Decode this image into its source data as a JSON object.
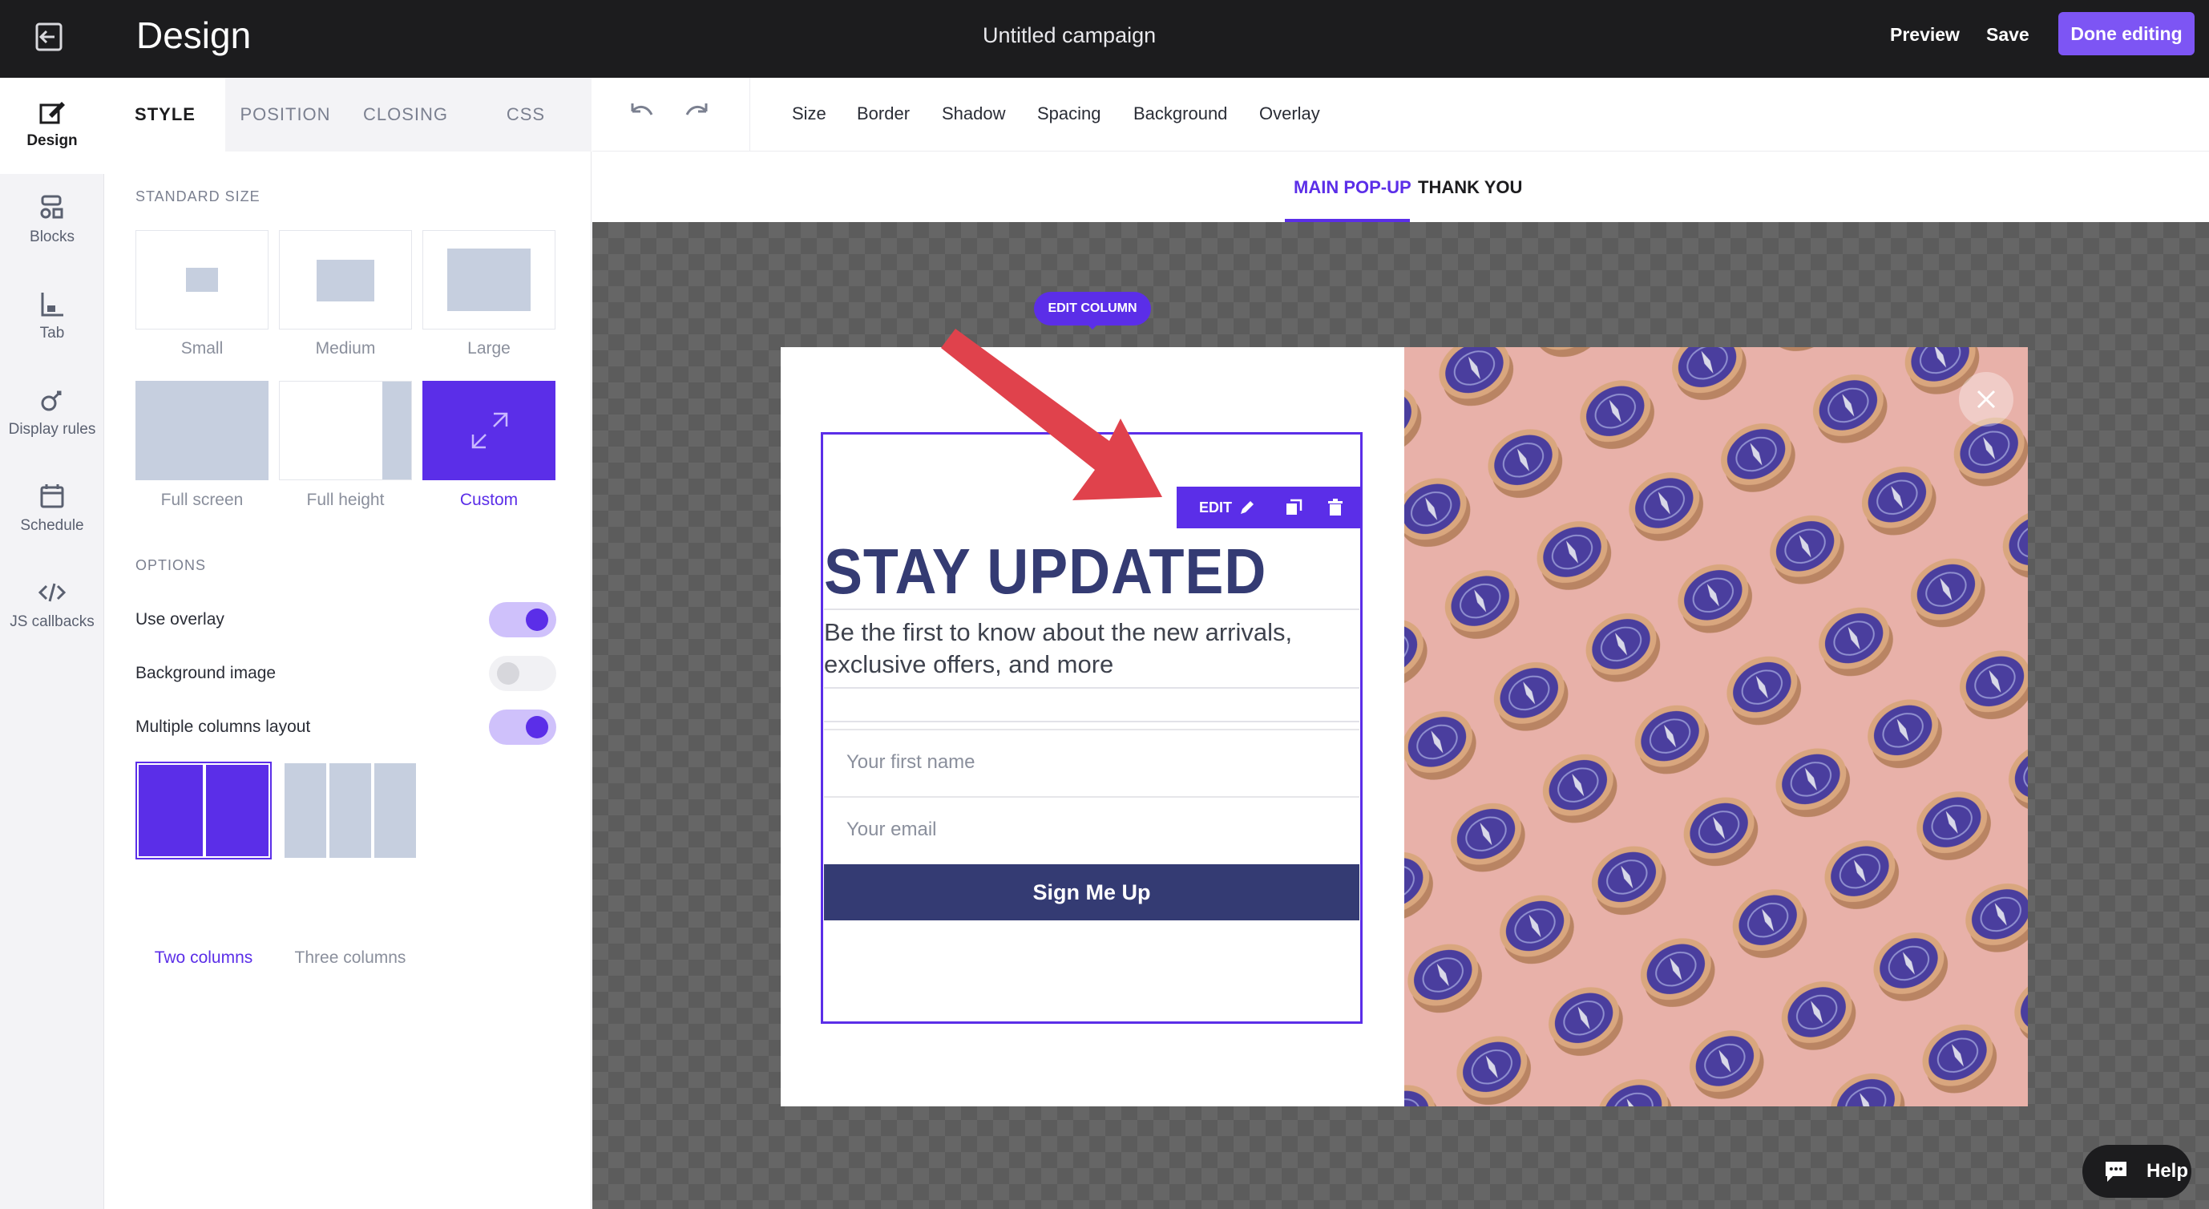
{
  "topbar": {
    "title": "Design",
    "campaign_name": "Untitled campaign",
    "preview_label": "Preview",
    "save_label": "Save",
    "done_label": "Done editing"
  },
  "rail": {
    "items": [
      {
        "label": "Design",
        "icon": "edit-icon"
      },
      {
        "label": "Blocks",
        "icon": "blocks-icon"
      },
      {
        "label": "Tab",
        "icon": "tab-icon"
      },
      {
        "label": "Display rules",
        "icon": "display-rules-icon"
      },
      {
        "label": "Schedule",
        "icon": "calendar-icon"
      },
      {
        "label": "JS callbacks",
        "icon": "code-icon"
      }
    ]
  },
  "panel": {
    "tabs": [
      "STYLE",
      "POSITION",
      "CLOSING",
      "CSS"
    ],
    "standard_size_heading": "STANDARD SIZE",
    "sizes": [
      "Small",
      "Medium",
      "Large",
      "Full screen",
      "Full height",
      "Custom"
    ],
    "selected_size": "Custom",
    "options_heading": "OPTIONS",
    "options": [
      {
        "label": "Use overlay",
        "on": true
      },
      {
        "label": "Background image",
        "on": false
      },
      {
        "label": "Multiple columns layout",
        "on": true
      }
    ],
    "layouts": [
      "Two columns",
      "Three columns"
    ],
    "selected_layout": "Two columns"
  },
  "toolbar": {
    "tools": [
      "Size",
      "Border",
      "Shadow",
      "Spacing",
      "Background",
      "Overlay"
    ]
  },
  "subtabs": [
    "MAIN POP-UP",
    "THANK YOU"
  ],
  "canvas": {
    "edit_column_label": "EDIT COLUMN",
    "edit_block_label": "EDIT",
    "heading": "STAY UPDATED",
    "description": "Be the first to know about the new arrivals, exclusive offers, and more",
    "first_name_placeholder": "Your first name",
    "email_placeholder": "Your email",
    "submit_label": "Sign Me Up"
  },
  "help_label": "Help",
  "colors": {
    "accent": "#5b2ee8",
    "done_button": "#7d55f4",
    "form_dark": "#343b73",
    "photo_bg": "#e8b1a9",
    "arrow": "#e0424c"
  }
}
